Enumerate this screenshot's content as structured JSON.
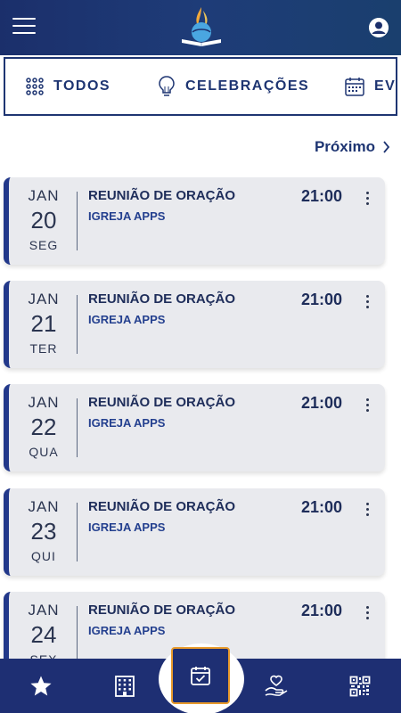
{
  "header": {
    "menu_icon": "hamburger-icon",
    "logo_icon": "church-logo-icon",
    "profile_icon": "user-icon"
  },
  "filters": [
    {
      "label": "TODOS",
      "icon": "grid-icon"
    },
    {
      "label": "CELEBRAÇÕES",
      "icon": "lightbulb-icon"
    },
    {
      "label": "EVE",
      "icon": "calendar-icon"
    }
  ],
  "pager": {
    "next_label": "Próximo"
  },
  "events": [
    {
      "month": "JAN",
      "day": "20",
      "weekday": "SEG",
      "title": "REUNIÃO DE ORAÇÃO",
      "subtitle": "IGREJA APPS",
      "time": "21:00"
    },
    {
      "month": "JAN",
      "day": "21",
      "weekday": "TER",
      "title": "REUNIÃO DE ORAÇÃO",
      "subtitle": "IGREJA APPS",
      "time": "21:00"
    },
    {
      "month": "JAN",
      "day": "22",
      "weekday": "QUA",
      "title": "REUNIÃO DE ORAÇÃO",
      "subtitle": "IGREJA APPS",
      "time": "21:00"
    },
    {
      "month": "JAN",
      "day": "23",
      "weekday": "QUI",
      "title": "REUNIÃO DE ORAÇÃO",
      "subtitle": "IGREJA APPS",
      "time": "21:00"
    },
    {
      "month": "JAN",
      "day": "24",
      "weekday": "SEX",
      "title": "REUNIÃO DE ORAÇÃO",
      "subtitle": "IGREJA APPS",
      "time": "21:00"
    }
  ],
  "bottom_nav": [
    {
      "icon": "star-icon"
    },
    {
      "icon": "building-icon"
    },
    {
      "icon": "calendar-check-icon",
      "active": true
    },
    {
      "icon": "hand-heart-icon"
    },
    {
      "icon": "qr-code-icon"
    }
  ],
  "colors": {
    "primary": "#1e2f73",
    "accent": "#e89a2c",
    "card_bg": "#e9eaee"
  }
}
